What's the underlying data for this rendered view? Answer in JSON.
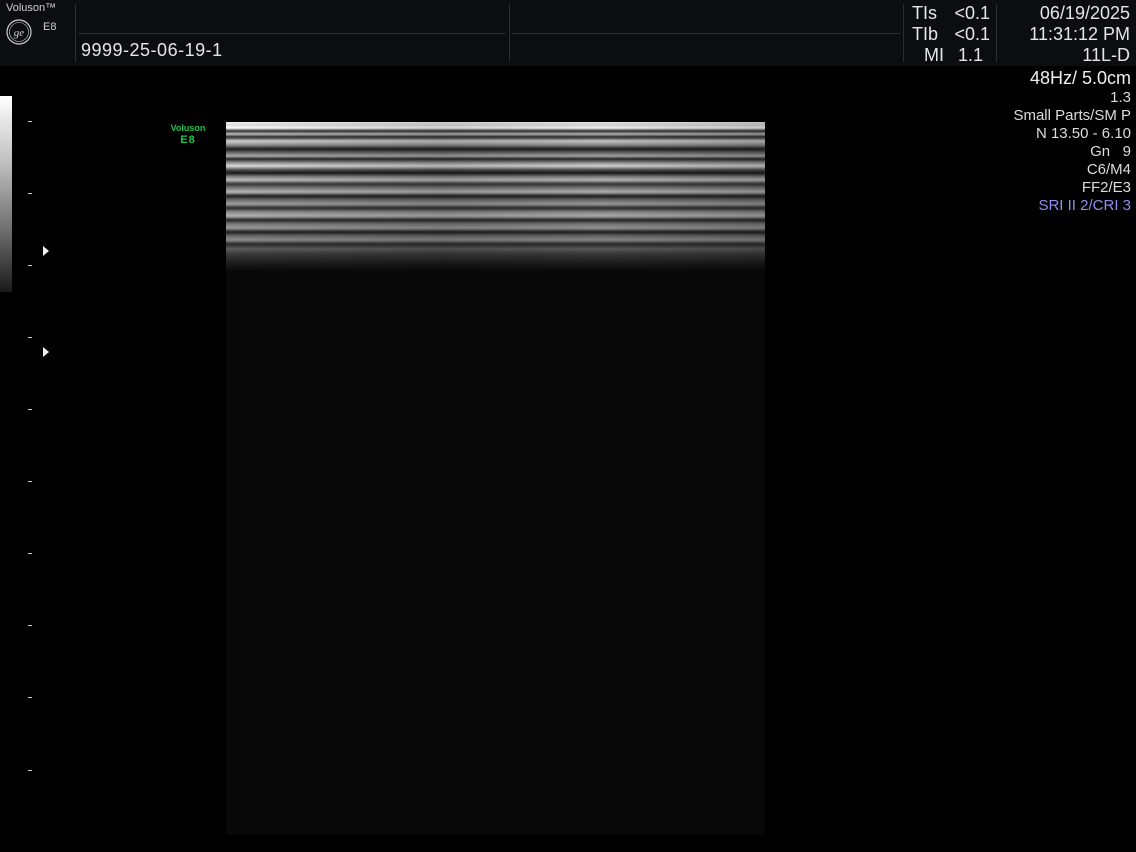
{
  "header": {
    "brand": "Voluson™",
    "model": "E8",
    "patient_id": "9999-25-06-19-1",
    "safety": {
      "tis_label": "TIs",
      "tis_value": "<0.1",
      "tib_label": "TIb",
      "tib_value": "<0.1",
      "mi_label": "MI",
      "mi_value": "1.1"
    },
    "date": "06/19/2025",
    "time": "11:31:12 PM",
    "probe": "11L-D"
  },
  "info_panel": {
    "frame_rate_depth": "48Hz/ 5.0cm",
    "zoom": "1.3",
    "preset": "Small Parts/SM P",
    "frequency": "N 13.50 - 6.10",
    "gain": "Gn   9",
    "contrast_map": "C6/M4",
    "filter": "FF2/E3",
    "sri_cri": "SRI II 2/CRI 3"
  },
  "image_logo": {
    "line1": "Voluson",
    "line2": "E8"
  },
  "colors": {
    "header_bg": "#0b0d10",
    "image_logo": "#1fc24a",
    "sri_text": "#8f8ff0"
  },
  "icons": {
    "logo": "ge-logo-icon",
    "focus": "focus-marker-icon"
  }
}
